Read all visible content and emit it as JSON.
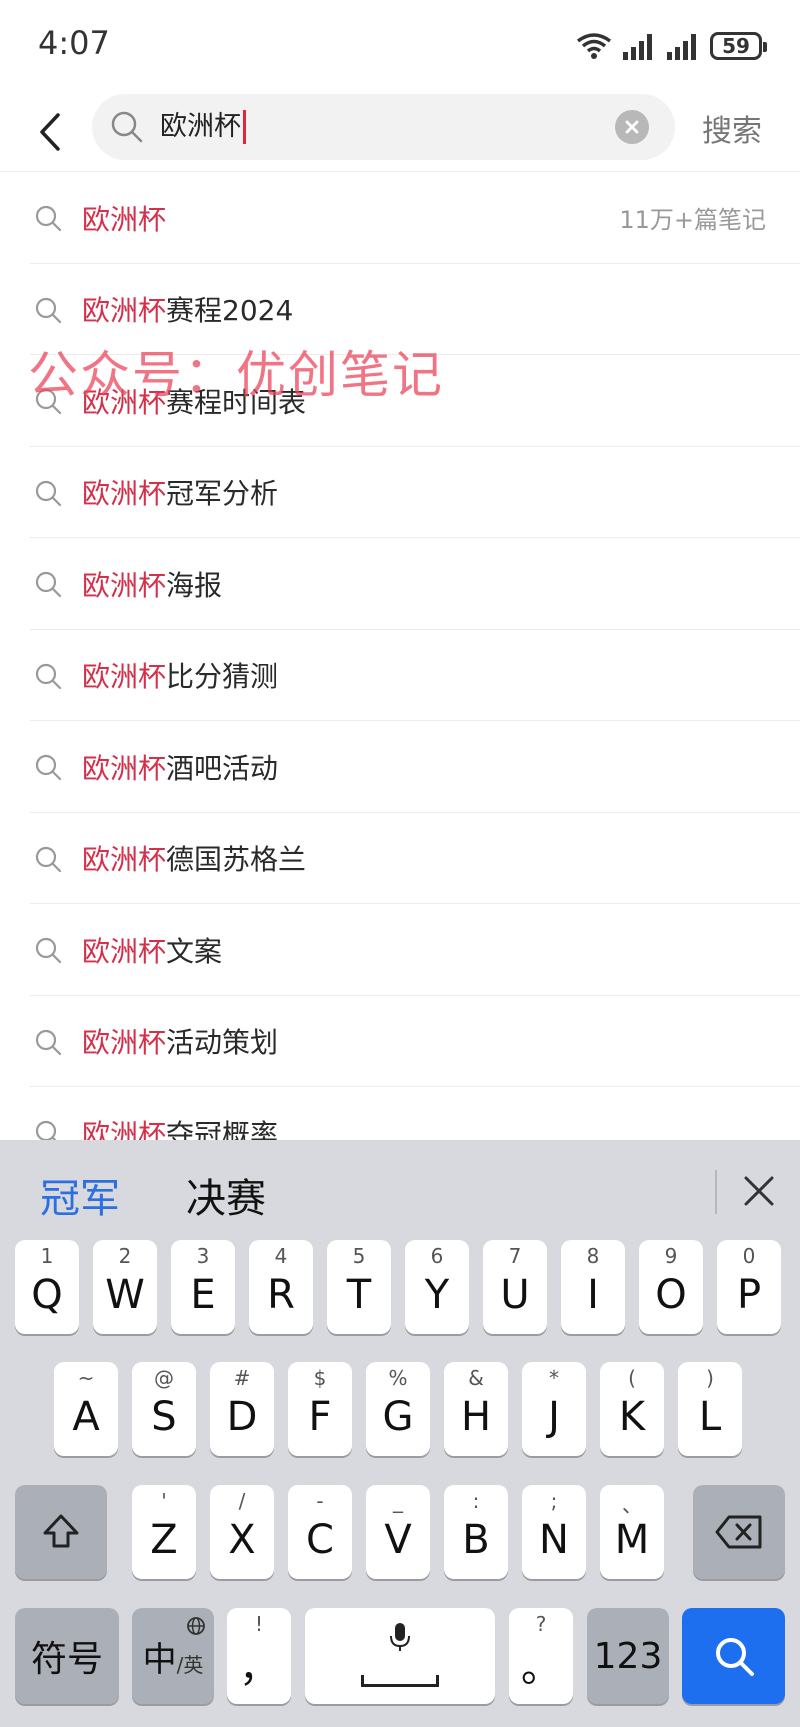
{
  "status_bar": {
    "time": "4:07",
    "battery": "59"
  },
  "search": {
    "query": "欧洲杯",
    "submit_label": "搜索"
  },
  "suggestions": [
    {
      "highlight": "欧洲杯",
      "rest": "",
      "meta": "11万+篇笔记"
    },
    {
      "highlight": "欧洲杯",
      "rest": "赛程2024",
      "meta": ""
    },
    {
      "highlight": "欧洲杯",
      "rest": "赛程时间表",
      "meta": ""
    },
    {
      "highlight": "欧洲杯",
      "rest": "冠军分析",
      "meta": ""
    },
    {
      "highlight": "欧洲杯",
      "rest": "海报",
      "meta": ""
    },
    {
      "highlight": "欧洲杯",
      "rest": "比分猜测",
      "meta": ""
    },
    {
      "highlight": "欧洲杯",
      "rest": "酒吧活动",
      "meta": ""
    },
    {
      "highlight": "欧洲杯",
      "rest": "德国苏格兰",
      "meta": ""
    },
    {
      "highlight": "欧洲杯",
      "rest": "文案",
      "meta": ""
    },
    {
      "highlight": "欧洲杯",
      "rest": "活动策划",
      "meta": ""
    },
    {
      "highlight": "欧洲杯",
      "rest": "夺冠概率",
      "meta": ""
    }
  ],
  "watermark": "公众号：优创笔记",
  "keyboard": {
    "candidates": [
      "冠军",
      "决赛"
    ],
    "row1": [
      {
        "main": "Q",
        "sub": "1"
      },
      {
        "main": "W",
        "sub": "2"
      },
      {
        "main": "E",
        "sub": "3"
      },
      {
        "main": "R",
        "sub": "4"
      },
      {
        "main": "T",
        "sub": "5"
      },
      {
        "main": "Y",
        "sub": "6"
      },
      {
        "main": "U",
        "sub": "7"
      },
      {
        "main": "I",
        "sub": "8"
      },
      {
        "main": "O",
        "sub": "9"
      },
      {
        "main": "P",
        "sub": "0"
      }
    ],
    "row2": [
      {
        "main": "A",
        "sub": "~"
      },
      {
        "main": "S",
        "sub": "@"
      },
      {
        "main": "D",
        "sub": "#"
      },
      {
        "main": "F",
        "sub": "$"
      },
      {
        "main": "G",
        "sub": "%"
      },
      {
        "main": "H",
        "sub": "&"
      },
      {
        "main": "J",
        "sub": "*"
      },
      {
        "main": "K",
        "sub": "("
      },
      {
        "main": "L",
        "sub": ")"
      }
    ],
    "row3": [
      {
        "main": "Z",
        "sub": "'"
      },
      {
        "main": "X",
        "sub": "/"
      },
      {
        "main": "C",
        "sub": "-"
      },
      {
        "main": "V",
        "sub": "_"
      },
      {
        "main": "B",
        "sub": ":"
      },
      {
        "main": "N",
        "sub": ";"
      },
      {
        "main": "M",
        "sub": "、"
      }
    ],
    "symbols_label": "符号",
    "lang_main": "中",
    "lang_sub": "/英",
    "comma_main": "，",
    "comma_sub": "!",
    "period_main": "。",
    "period_sub": "?",
    "numbers_label": "123",
    "icons": {
      "shift": "shift-icon",
      "backspace": "backspace-icon",
      "globe": "globe-icon",
      "mic": "microphone-icon",
      "search": "search-icon"
    }
  },
  "colors": {
    "highlight": "#d4304a",
    "accent": "#1e6ff0",
    "candidate_active": "#2b6fe0"
  }
}
